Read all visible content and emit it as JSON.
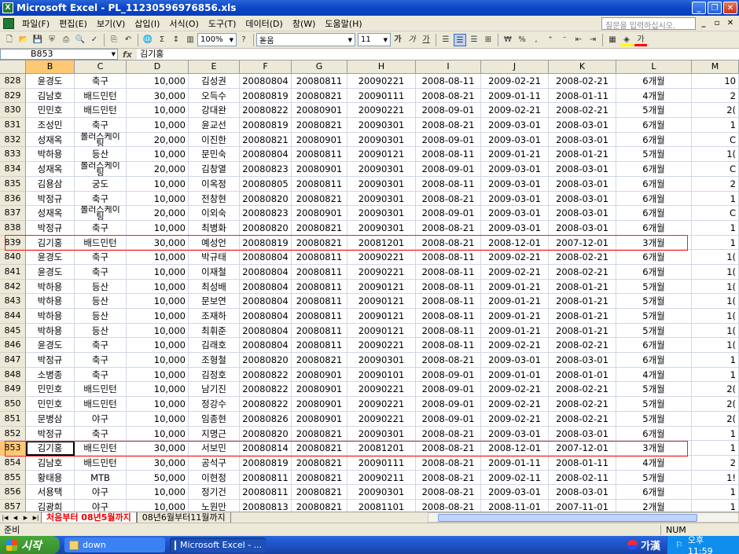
{
  "window": {
    "title": "Microsoft Excel - PL_11230596976856.xls",
    "icon": "excel-icon"
  },
  "menu": {
    "items": [
      "파일(F)",
      "편집(E)",
      "보기(V)",
      "삽입(I)",
      "서식(O)",
      "도구(T)",
      "데이터(D)",
      "창(W)",
      "도움말(H)"
    ],
    "help_placeholder": "질문을 입력하십시오."
  },
  "toolbar": {
    "zoom": "100%",
    "font": "돋움",
    "font_size": "11",
    "bold": "가",
    "italic": "가",
    "underline": "가",
    "currency": "₩",
    "percent": "%"
  },
  "formula": {
    "cell_ref": "B853",
    "fx": "fx",
    "content": "김기홍"
  },
  "grid": {
    "columns": [
      {
        "id": "B",
        "w": 62
      },
      {
        "id": "C",
        "w": 66
      },
      {
        "id": "D",
        "w": 79
      },
      {
        "id": "E",
        "w": 65
      },
      {
        "id": "F",
        "w": 66
      },
      {
        "id": "G",
        "w": 71
      },
      {
        "id": "H",
        "w": 87
      },
      {
        "id": "I",
        "w": 83
      },
      {
        "id": "J",
        "w": 86
      },
      {
        "id": "K",
        "w": 86
      },
      {
        "id": "L",
        "w": 96
      },
      {
        "id": "M",
        "w": 60
      }
    ],
    "selected_col": "B",
    "selected_row": "853",
    "rows": [
      [
        "828",
        "윤경도",
        "축구",
        "10,000",
        "김성권",
        "20080804",
        "20080811",
        "20090221",
        "2008-08-11",
        "2009-02-21",
        "2008-02-21",
        "6개월",
        "10"
      ],
      [
        "829",
        "김남호",
        "배드민턴",
        "30,000",
        "오득수",
        "20080819",
        "20080821",
        "20090111",
        "2008-08-21",
        "2009-01-11",
        "2008-01-11",
        "4개월",
        "2"
      ],
      [
        "830",
        "민민호",
        "배드민턴",
        "10,000",
        "강대완",
        "20080822",
        "20080901",
        "20090221",
        "2008-09-01",
        "2009-02-21",
        "2008-02-21",
        "5개월",
        "2("
      ],
      [
        "831",
        "조성민",
        "축구",
        "10,000",
        "윤교선",
        "20080819",
        "20080821",
        "20090301",
        "2008-08-21",
        "2009-03-01",
        "2008-03-01",
        "6개월",
        "1"
      ],
      [
        "832",
        "성재옥",
        "볼러스케이팅",
        "20,000",
        "이진한",
        "20080821",
        "20080901",
        "20090301",
        "2008-09-01",
        "2009-03-01",
        "2008-03-01",
        "6개월",
        "C"
      ],
      [
        "833",
        "박하용",
        "등산",
        "10,000",
        "문민숙",
        "20080804",
        "20080811",
        "20090121",
        "2008-08-11",
        "2009-01-21",
        "2008-01-21",
        "5개월",
        "1("
      ],
      [
        "834",
        "성재옥",
        "볼러스케이팅",
        "20,000",
        "김창열",
        "20080823",
        "20080901",
        "20090301",
        "2008-09-01",
        "2009-03-01",
        "2008-03-01",
        "6개월",
        "C"
      ],
      [
        "835",
        "김용삼",
        "궁도",
        "10,000",
        "이옥정",
        "20080805",
        "20080811",
        "20090301",
        "2008-08-11",
        "2009-03-01",
        "2008-03-01",
        "6개월",
        "2"
      ],
      [
        "836",
        "박정규",
        "축구",
        "10,000",
        "전창현",
        "20080820",
        "20080821",
        "20090301",
        "2008-08-21",
        "2009-03-01",
        "2008-03-01",
        "6개월",
        "1"
      ],
      [
        "837",
        "성재옥",
        "볼러스케이팅",
        "20,000",
        "이외숙",
        "20080823",
        "20080901",
        "20090301",
        "2008-09-01",
        "2009-03-01",
        "2008-03-01",
        "6개월",
        "C"
      ],
      [
        "838",
        "박정규",
        "축구",
        "10,000",
        "최병화",
        "20080820",
        "20080821",
        "20090301",
        "2008-08-21",
        "2009-03-01",
        "2008-03-01",
        "6개월",
        "1"
      ],
      [
        "839",
        "김기홍",
        "배드민턴",
        "30,000",
        "예성언",
        "20080819",
        "20080821",
        "20081201",
        "2008-08-21",
        "2008-12-01",
        "2007-12-01",
        "3개월",
        "1"
      ],
      [
        "840",
        "윤경도",
        "축구",
        "10,000",
        "박규태",
        "20080804",
        "20080811",
        "20090221",
        "2008-08-11",
        "2009-02-21",
        "2008-02-21",
        "6개월",
        "1("
      ],
      [
        "841",
        "윤경도",
        "축구",
        "10,000",
        "이재철",
        "20080804",
        "20080811",
        "20090221",
        "2008-08-11",
        "2009-02-21",
        "2008-02-21",
        "6개월",
        "1("
      ],
      [
        "842",
        "박하용",
        "등산",
        "10,000",
        "최성배",
        "20080804",
        "20080811",
        "20090121",
        "2008-08-11",
        "2009-01-21",
        "2008-01-21",
        "5개월",
        "1("
      ],
      [
        "843",
        "박하용",
        "등산",
        "10,000",
        "문보연",
        "20080804",
        "20080811",
        "20090121",
        "2008-08-11",
        "2009-01-21",
        "2008-01-21",
        "5개월",
        "1("
      ],
      [
        "844",
        "박하용",
        "등산",
        "10,000",
        "조재하",
        "20080804",
        "20080811",
        "20090121",
        "2008-08-11",
        "2009-01-21",
        "2008-01-21",
        "5개월",
        "1("
      ],
      [
        "845",
        "박하용",
        "등산",
        "10,000",
        "최휘준",
        "20080804",
        "20080811",
        "20090121",
        "2008-08-11",
        "2009-01-21",
        "2008-01-21",
        "5개월",
        "1("
      ],
      [
        "846",
        "윤경도",
        "축구",
        "10,000",
        "김래호",
        "20080804",
        "20080811",
        "20090221",
        "2008-08-11",
        "2009-02-21",
        "2008-02-21",
        "6개월",
        "1("
      ],
      [
        "847",
        "박정규",
        "축구",
        "10,000",
        "조형철",
        "20080820",
        "20080821",
        "20090301",
        "2008-08-21",
        "2009-03-01",
        "2008-03-01",
        "6개월",
        "1"
      ],
      [
        "848",
        "소병종",
        "축구",
        "10,000",
        "김정호",
        "20080822",
        "20080901",
        "20090101",
        "2008-09-01",
        "2009-01-01",
        "2008-01-01",
        "4개월",
        "1"
      ],
      [
        "849",
        "민민호",
        "배드민턴",
        "10,000",
        "남기진",
        "20080822",
        "20080901",
        "20090221",
        "2008-09-01",
        "2009-02-21",
        "2008-02-21",
        "5개월",
        "2("
      ],
      [
        "850",
        "민민호",
        "배드민턴",
        "10,000",
        "정강수",
        "20080822",
        "20080901",
        "20090221",
        "2008-09-01",
        "2009-02-21",
        "2008-02-21",
        "5개월",
        "2("
      ],
      [
        "851",
        "문병삼",
        "야구",
        "10,000",
        "임종현",
        "20080826",
        "20080901",
        "20090221",
        "2008-09-01",
        "2009-02-21",
        "2008-02-21",
        "5개월",
        "2("
      ],
      [
        "852",
        "박정규",
        "축구",
        "10,000",
        "지명근",
        "20080820",
        "20080821",
        "20090301",
        "2008-08-21",
        "2009-03-01",
        "2008-03-01",
        "6개월",
        "1"
      ],
      [
        "853",
        "김기홍",
        "배드민턴",
        "30,000",
        "서보민",
        "20080814",
        "20080821",
        "20081201",
        "2008-08-21",
        "2008-12-01",
        "2007-12-01",
        "3개월",
        "1"
      ],
      [
        "854",
        "김남호",
        "배드민턴",
        "30,000",
        "공석구",
        "20080819",
        "20080821",
        "20090111",
        "2008-08-21",
        "2009-01-11",
        "2008-01-11",
        "4개월",
        "2"
      ],
      [
        "855",
        "황태용",
        "MTB",
        "50,000",
        "이현정",
        "20080811",
        "20080821",
        "20090211",
        "2008-08-21",
        "2009-02-11",
        "2008-02-11",
        "5개월",
        "1!"
      ],
      [
        "856",
        "서용택",
        "야구",
        "10,000",
        "정기건",
        "20080811",
        "20080821",
        "20090301",
        "2008-08-21",
        "2009-03-01",
        "2008-03-01",
        "6개월",
        "1"
      ],
      [
        "857",
        "김광희",
        "야구",
        "10,000",
        "노원만",
        "20080813",
        "20080821",
        "20081101",
        "2008-08-21",
        "2008-11-01",
        "2007-11-01",
        "2개월",
        "1"
      ]
    ],
    "highlight_rows": [
      "839",
      "853"
    ]
  },
  "sheets": {
    "active": "처음부터 08년5월까지",
    "other": "08년6월부터11월까지"
  },
  "status": {
    "text": "준비",
    "num": "NUM"
  },
  "taskbar": {
    "start": "시작",
    "tasks": [
      {
        "label": "down",
        "icon": "folder-icon"
      },
      {
        "label": "Microsoft Excel - ...",
        "icon": "excel-icon"
      }
    ],
    "ime": "가漢",
    "clock": "오후 11:59"
  }
}
